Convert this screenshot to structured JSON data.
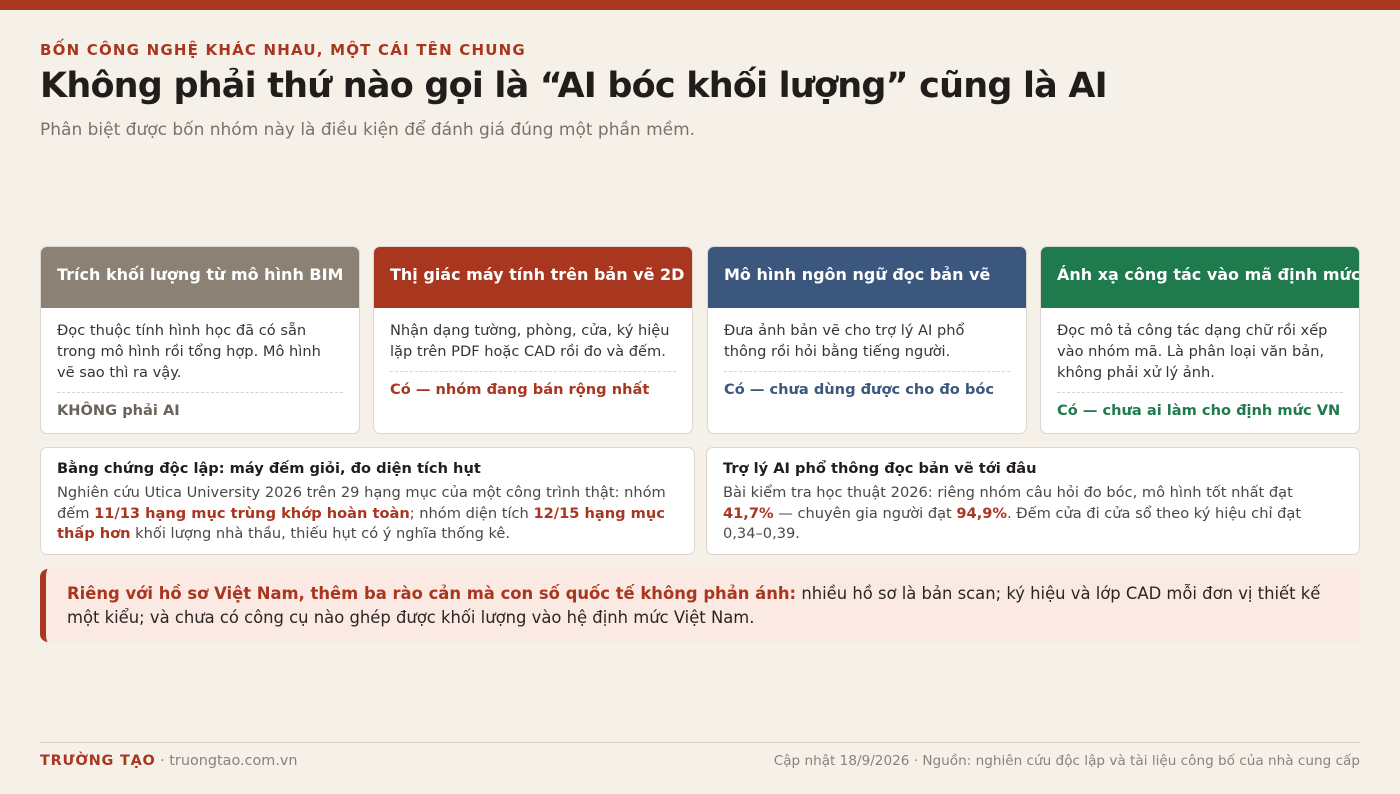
{
  "header": {
    "eyebrow": "BỐN CÔNG NGHỆ KHÁC NHAU, MỘT CÁI TÊN CHUNG",
    "title": "Không phải thứ nào gọi là “AI bóc khối lượng” cũng là AI",
    "subtitle": "Phân biệt được bốn nhóm này là điều kiện để đánh giá đúng một phần mềm."
  },
  "colors": {
    "accent": "#a9361f",
    "bim": "#8b8275",
    "vision": "#a9361f",
    "llm": "#3b577d",
    "mapping": "#1f7a4d"
  },
  "cards": [
    {
      "title": "Trích khối lượng từ mô hình BIM",
      "description": "Đọc thuộc tính hình học đã có sẵn trong mô hình rồi tổng hợp. Mô hình vẽ sao thì ra vậy.",
      "verdict": "KHÔNG phải AI"
    },
    {
      "title": "Thị giác máy tính trên bản vẽ 2D",
      "description": "Nhận dạng tường, phòng, cửa, ký hiệu lặp trên PDF hoặc CAD rồi đo và đếm.",
      "verdict": "Có — nhóm đang bán rộng nhất"
    },
    {
      "title": "Mô hình ngôn ngữ đọc bản vẽ",
      "description": "Đưa ảnh bản vẽ cho trợ lý AI phổ thông rồi hỏi bằng tiếng người.",
      "verdict": "Có — chưa dùng được cho đo bóc"
    },
    {
      "title": "Ánh xạ công tác vào mã định mức",
      "description": "Đọc mô tả công tác dạng chữ rồi xếp vào nhóm mã. Là phân loại văn bản, không phải xử lý ảnh.",
      "verdict": "Có — chưa ai làm cho định mức VN"
    }
  ],
  "evidence": [
    {
      "title": "Bằng chứng độc lập: máy đếm giỏi, đo diện tích hụt",
      "t1": "Nghiên cứu Utica University 2026 trên 29 hạng mục của một công trình thật: nhóm đếm ",
      "h1": "11/13 hạng mục trùng khớp hoàn toàn",
      "t2": "; nhóm diện tích ",
      "h2": "12/15 hạng mục thấp hơn",
      "t3": " khối lượng nhà thầu, thiếu hụt có ý nghĩa thống kê."
    },
    {
      "title": "Trợ lý AI phổ thông đọc bản vẽ tới đâu",
      "t1": "Bài kiểm tra học thuật 2026: riêng nhóm câu hỏi đo bóc, mô hình tốt nhất đạt ",
      "h1": "41,7%",
      "t2": " — chuyên gia người đạt ",
      "h2": "94,9%",
      "t3": ". Đếm cửa đi cửa sổ theo ký hiệu chỉ đạt 0,34–0,39."
    }
  ],
  "note": {
    "lead": "Riêng với hồ sơ Việt Nam, thêm ba rào cản mà con số quốc tế không phản ánh:",
    "text": " nhiều hồ sơ là bản scan; ký hiệu và lớp CAD mỗi đơn vị thiết kế một kiểu; và chưa có công cụ nào ghép được khối lượng vào hệ định mức Việt Nam."
  },
  "footer": {
    "brand": "TRƯỜNG TẠO",
    "site": " · truongtao.com.vn",
    "source": "Cập nhật 18/9/2026 · Nguồn: nghiên cứu độc lập và tài liệu công bố của nhà cung cấp"
  }
}
